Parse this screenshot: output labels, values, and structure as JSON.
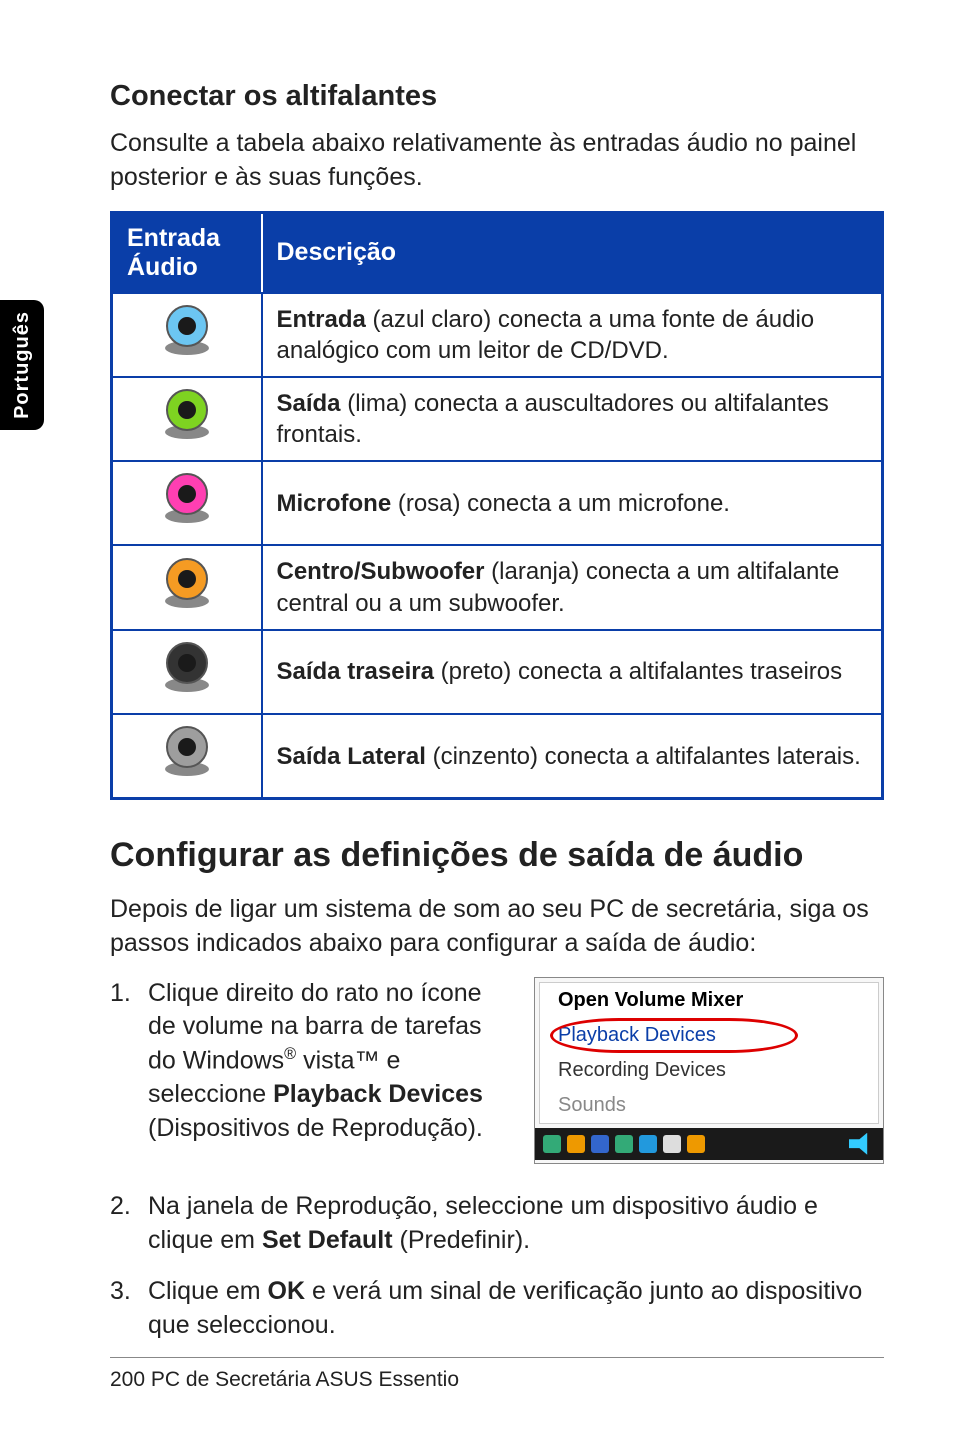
{
  "sideTab": "Português",
  "section1": {
    "title": "Conectar os altifalantes",
    "intro": "Consulte a tabela abaixo relativamente às entradas áudio no painel posterior e às suas funções."
  },
  "table": {
    "headers": {
      "col1": "Entrada Áudio",
      "col2": "Descrição"
    },
    "rows": [
      {
        "color": "#6cc6f2",
        "bold": "Entrada",
        "rest": " (azul claro) conecta a uma fonte de áudio analógico com um leitor de CD/DVD."
      },
      {
        "color": "#7ed321",
        "bold": "Saída",
        "rest": " (lima) conecta a auscultadores ou altifalantes frontais."
      },
      {
        "color": "#ff3fb2",
        "bold": "Microfone",
        "rest": " (rosa) conecta a um microfone."
      },
      {
        "color": "#f59b23",
        "bold": "Centro/Subwoofer",
        "rest": " (laranja) conecta a um altifalante central ou a um subwoofer."
      },
      {
        "color": "#333333",
        "bold": "Saída traseira",
        "rest": " (preto) conecta a altifalantes traseiros"
      },
      {
        "color": "#9e9e9e",
        "bold": "Saída Lateral",
        "rest": " (cinzento) conecta a altifalantes laterais."
      }
    ]
  },
  "section2": {
    "title": "Configurar as definições de saída de áudio",
    "intro": "Depois de ligar um sistema de som ao seu PC de secretária, siga os passos indicados abaixo para configurar a saída de áudio:"
  },
  "steps": {
    "s1": {
      "num": "1.",
      "a": "Clique direito do rato no ícone de volume na barra de tarefas do Windows",
      "reg": "®",
      "b": " vista™ e seleccione ",
      "bold": "Playback Devices",
      "c": " (Dispositivos de Reprodução)."
    },
    "s2": {
      "num": "2.",
      "a": "Na janela de Reprodução, seleccione um dispositivo áudio e clique em ",
      "bold": "Set Default",
      "b": " (Predefinir)."
    },
    "s3": {
      "num": "3.",
      "a": "Clique em ",
      "bold": "OK",
      "b": " e verá um sinal de verificação junto ao dispositivo que seleccionou."
    }
  },
  "menu": {
    "open": "Open Volume Mixer",
    "playback": "Playback Devices",
    "recording": "Recording Devices",
    "sounds": "Sounds"
  },
  "footer": {
    "page": "200",
    "title": " PC de Secretária ASUS Essentio"
  },
  "chart_data": {
    "type": "table",
    "title": "Entrada Áudio — Descrição",
    "columns": [
      "Entrada Áudio (cor)",
      "Descrição"
    ],
    "rows": [
      [
        "azul claro",
        "Entrada — conecta a uma fonte de áudio analógico com um leitor de CD/DVD."
      ],
      [
        "lima",
        "Saída — conecta a auscultadores ou altifalantes frontais."
      ],
      [
        "rosa",
        "Microfone — conecta a um microfone."
      ],
      [
        "laranja",
        "Centro/Subwoofer — conecta a um altifalante central ou a um subwoofer."
      ],
      [
        "preto",
        "Saída traseira — conecta a altifalantes traseiros"
      ],
      [
        "cinzento",
        "Saída Lateral — conecta a altifalantes laterais."
      ]
    ]
  }
}
